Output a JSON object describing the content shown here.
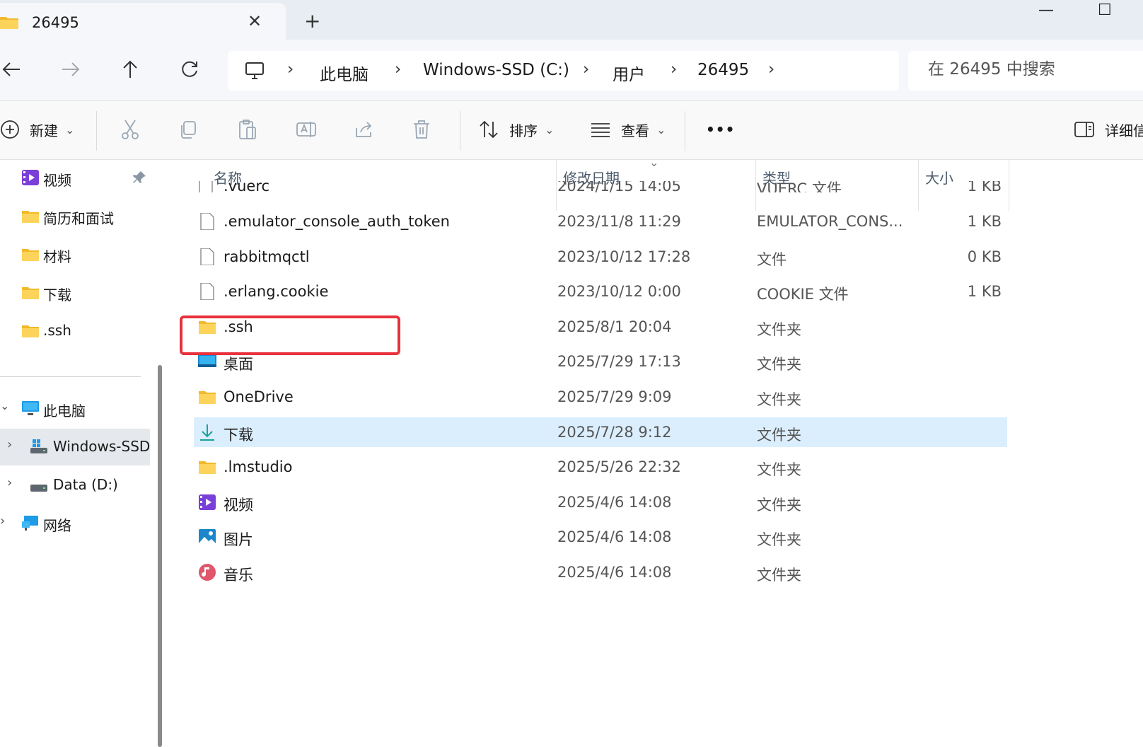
{
  "window": {
    "tab_title": "26495",
    "close_tab_glyph": "✕",
    "new_tab_glyph": "+",
    "minimize_glyph": "—",
    "maximize_glyph": "☐"
  },
  "nav": {
    "back_icon": "arrow-left-icon",
    "forward_icon": "arrow-right-icon",
    "up_icon": "arrow-up-icon",
    "refresh_icon": "refresh-icon",
    "breadcrumb": [
      "此电脑",
      "Windows-SSD (C:)",
      "用户",
      "26495"
    ],
    "chevron": "›",
    "search_placeholder": "在 26495 中搜索"
  },
  "commandbar": {
    "new_label": "新建",
    "sort_label": "排序",
    "view_label": "查看",
    "more_label": "•••",
    "details_label": "详细信",
    "caret": "⌄"
  },
  "sidebar": {
    "quick_access": [
      {
        "label": "视频",
        "icon": "video-icon",
        "pinned": true
      },
      {
        "label": "简历和面试",
        "icon": "folder-icon"
      },
      {
        "label": "材料",
        "icon": "folder-icon"
      },
      {
        "label": "下载",
        "icon": "folder-icon"
      },
      {
        "label": ".ssh",
        "icon": "folder-icon"
      }
    ],
    "this_pc": {
      "label": "此电脑",
      "icon": "computer-icon",
      "expand": "⌄"
    },
    "drives": [
      {
        "label": "Windows-SSD (C:)",
        "icon": "drive-c-icon",
        "selected": true,
        "expand": "›"
      },
      {
        "label": "Data (D:)",
        "icon": "drive-d-icon",
        "expand": "›"
      }
    ],
    "network": {
      "label": "网络",
      "icon": "network-icon",
      "expand": "›"
    }
  },
  "columns": {
    "name": "名称",
    "date": "修改日期",
    "type": "类型",
    "size": "大小",
    "sort_caret": "⌄"
  },
  "cutoff_row": {
    "name": ".vuerc",
    "date": "2024/1/15 14:05",
    "type": "VUERC 文件",
    "size": "1 KB"
  },
  "files": [
    {
      "name": ".emulator_console_auth_token",
      "date": "2023/11/8 11:29",
      "type": "EMULATOR_CONS...",
      "size": "1 KB",
      "icon": "file-icon"
    },
    {
      "name": "rabbitmqctl",
      "date": "2023/10/12 17:28",
      "type": "文件",
      "size": "0 KB",
      "icon": "file-icon"
    },
    {
      "name": ".erlang.cookie",
      "date": "2023/10/12 0:00",
      "type": "COOKIE 文件",
      "size": "1 KB",
      "icon": "file-icon"
    },
    {
      "name": ".ssh",
      "date": "2025/8/1 20:04",
      "type": "文件夹",
      "size": "",
      "icon": "folder-icon",
      "highlighted": true
    },
    {
      "name": "桌面",
      "date": "2025/7/29 17:13",
      "type": "文件夹",
      "size": "",
      "icon": "desktop-icon"
    },
    {
      "name": "OneDrive",
      "date": "2025/7/29 9:09",
      "type": "文件夹",
      "size": "",
      "icon": "folder-icon"
    },
    {
      "name": "下载",
      "date": "2025/7/28 9:12",
      "type": "文件夹",
      "size": "",
      "icon": "download-icon",
      "selected": true
    },
    {
      "name": ".lmstudio",
      "date": "2025/5/26 22:32",
      "type": "文件夹",
      "size": "",
      "icon": "folder-icon"
    },
    {
      "name": "视频",
      "date": "2025/4/6 14:08",
      "type": "文件夹",
      "size": "",
      "icon": "video-icon"
    },
    {
      "name": "图片",
      "date": "2025/4/6 14:08",
      "type": "文件夹",
      "size": "",
      "icon": "pictures-icon"
    },
    {
      "name": "音乐",
      "date": "2025/4/6 14:08",
      "type": "文件夹",
      "size": "",
      "icon": "music-icon"
    }
  ],
  "colors": {
    "highlight_border": "#e8323c",
    "selected_row": "#dbeefd",
    "folder_yellow": "#f7c948"
  }
}
